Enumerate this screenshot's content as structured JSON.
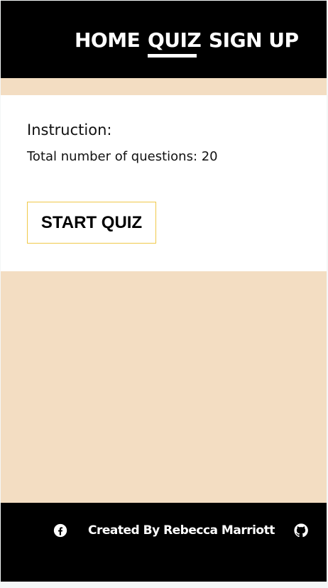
{
  "nav": {
    "items": [
      {
        "label": "HOME",
        "active": false
      },
      {
        "label": "QUIZ",
        "active": true
      },
      {
        "label": "SIGN UP",
        "active": false
      }
    ]
  },
  "quiz": {
    "instruction_title": "Instruction:",
    "question_count_text": "Total number of questions: 20",
    "start_button_label": "START QUIZ"
  },
  "footer": {
    "credit": "Created By Rebecca Marriott",
    "icons": [
      "facebook-icon",
      "github-icon"
    ]
  },
  "colors": {
    "header_bg": "#000000",
    "page_accent_bg": "#f3ddc2",
    "card_bg": "#ffffff",
    "button_border": "#f0c94a"
  }
}
